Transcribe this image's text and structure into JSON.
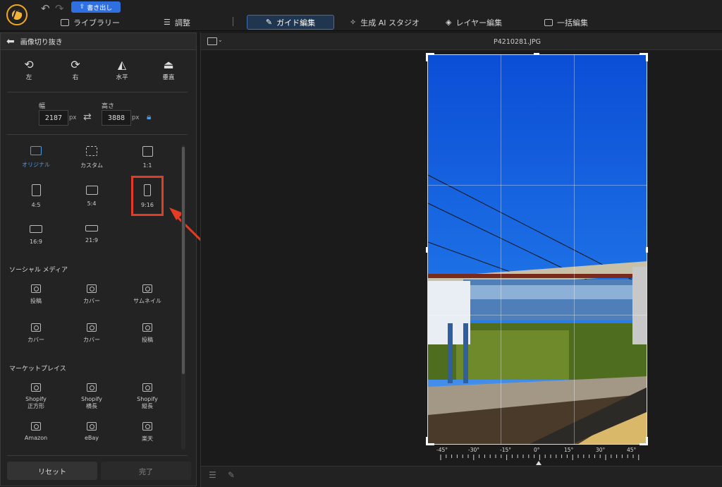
{
  "topbar": {
    "export_label": "書き出し",
    "tabs": [
      "ライブラリー",
      "調整",
      "ガイド編集",
      "生成 AI スタジオ",
      "レイヤー編集",
      "一括編集"
    ]
  },
  "panel": {
    "title": "画像切り抜き",
    "rotate": [
      "左",
      "右",
      "水平",
      "垂直"
    ],
    "width_label": "幅",
    "height_label": "高さ",
    "width_value": "2187",
    "height_value": "3888",
    "unit": "px",
    "ratios": [
      {
        "label": "オリジナル",
        "selected": true
      },
      {
        "label": "カスタム"
      },
      {
        "label": "1:1"
      },
      {
        "label": "4:5"
      },
      {
        "label": "5:4"
      },
      {
        "label": "9:16"
      },
      {
        "label": "16:9"
      },
      {
        "label": "21:9"
      }
    ],
    "social_title": "ソーシャル メディア",
    "social": [
      "投稿",
      "カバー",
      "サムネイル",
      "カバー",
      "カバー",
      "投稿"
    ],
    "market_title": "マーケットプレイス",
    "market": [
      "Shopify\n正方形",
      "Shopify\n横長",
      "Shopify\n縦長",
      "Amazon",
      "eBay",
      "楽天"
    ],
    "reset_label": "リセット",
    "done_label": "完了"
  },
  "canvas": {
    "filename": "P4210281.JPG",
    "degrees": [
      "-45°",
      "-30°",
      "-15°",
      "0°",
      "15°",
      "30°",
      "45°"
    ]
  },
  "colors": {
    "accent": "#4b9bec",
    "highlight": "#e33b24",
    "export": "#2f6fe0"
  }
}
